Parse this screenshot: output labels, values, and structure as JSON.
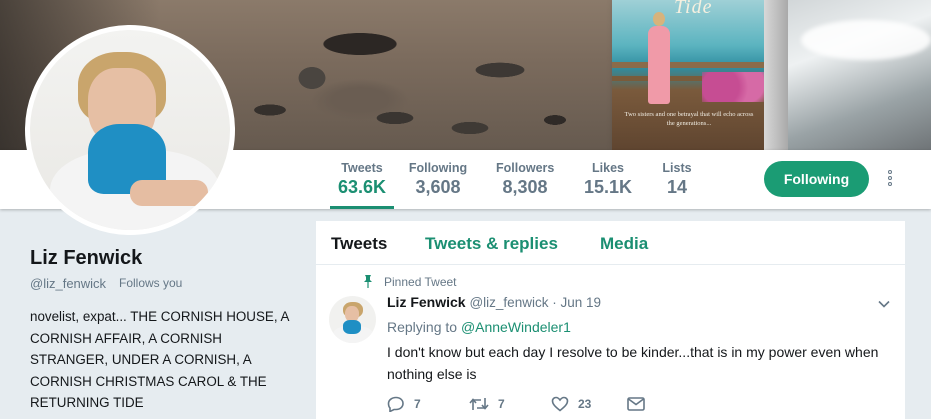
{
  "banner": {
    "book_title": "Tide",
    "book_tagline": "Two sisters and one betrayal that will echo across the generations..."
  },
  "nav": {
    "stats": [
      {
        "label": "Tweets",
        "value": "63.6K"
      },
      {
        "label": "Following",
        "value": "3,608"
      },
      {
        "label": "Followers",
        "value": "8,308"
      },
      {
        "label": "Likes",
        "value": "15.1K"
      },
      {
        "label": "Lists",
        "value": "14"
      }
    ],
    "follow_button": "Following"
  },
  "profile": {
    "name": "Liz Fenwick",
    "handle": "@liz_fenwick",
    "follows_you": "Follows you",
    "bio": "novelist, expat... THE CORNISH HOUSE, A CORNISH AFFAIR, A CORNISH STRANGER, UNDER A CORNISH, A CORNISH CHRISTMAS CAROL & THE RETURNING TIDE"
  },
  "timeline": {
    "tabs": [
      "Tweets",
      "Tweets & replies",
      "Media"
    ],
    "pinned_label": "Pinned Tweet",
    "tweet": {
      "author": "Liz Fenwick",
      "handle_time": "@liz_fenwick · Jun 19",
      "replying_prefix": "Replying to",
      "replying_to": "@AnneWindeler1",
      "text": "I don't know but each day I resolve to be kinder...that is in my power even when nothing else is",
      "replies": "7",
      "retweets": "7",
      "likes": "23"
    }
  },
  "colors": {
    "accent": "#1b8f72",
    "follow_button": "#1b9c74",
    "muted_text": "#657786"
  }
}
